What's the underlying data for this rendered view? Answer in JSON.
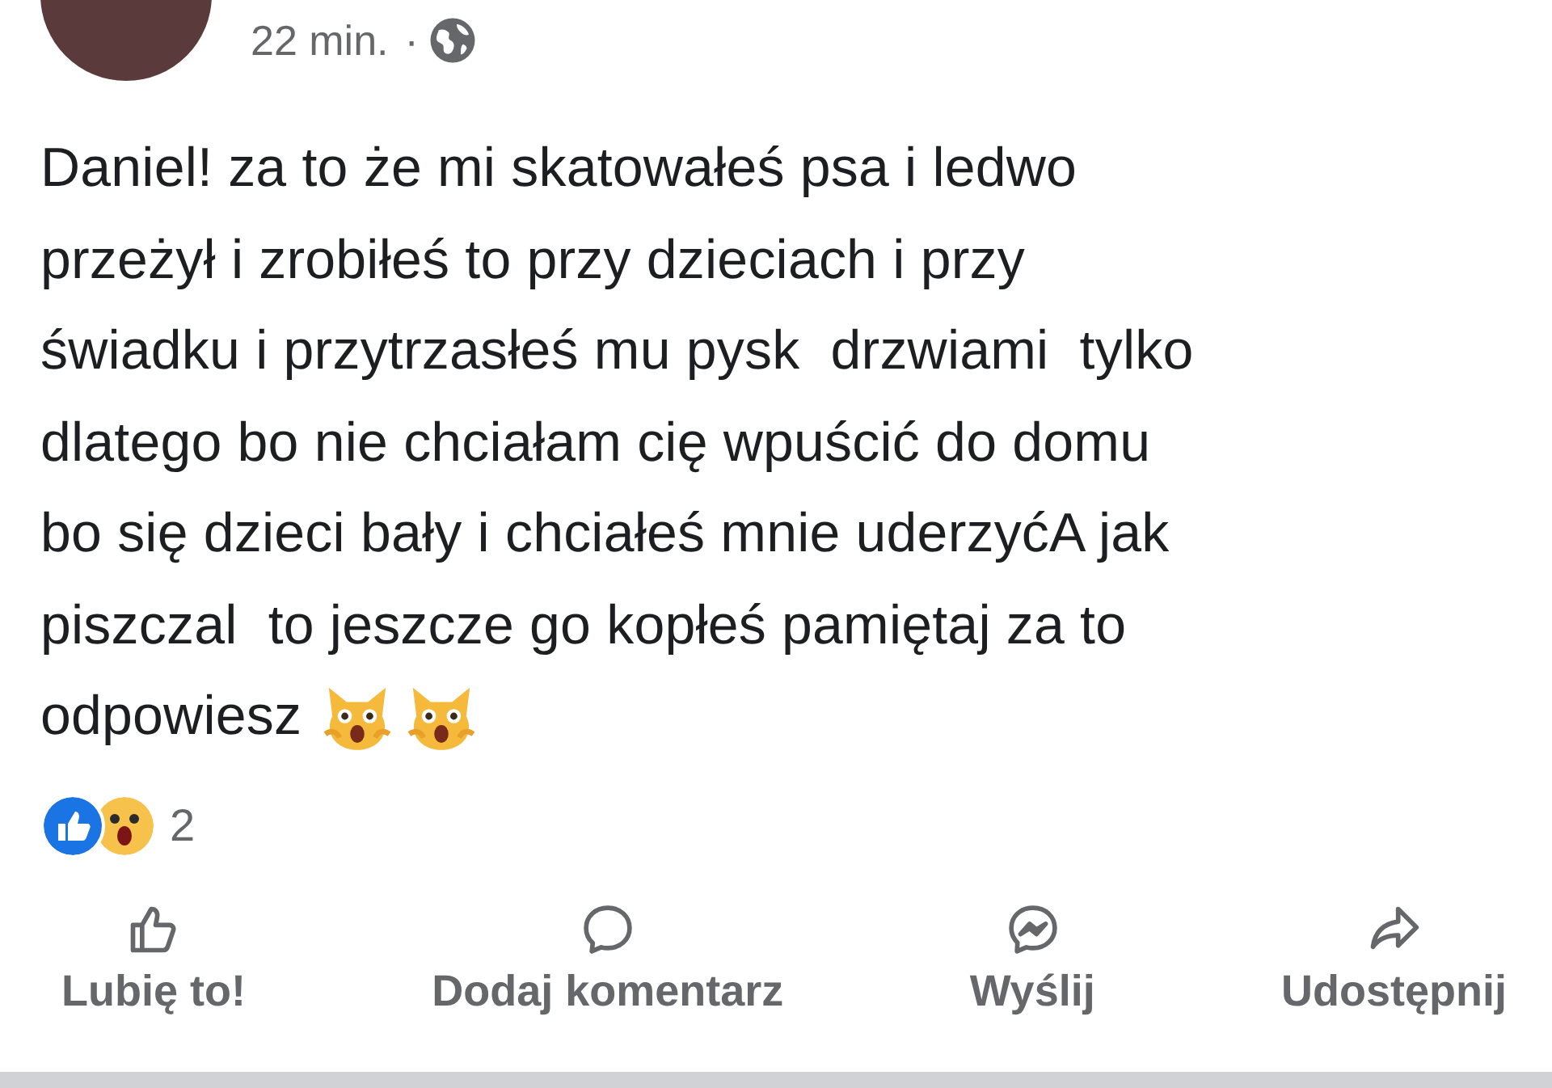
{
  "post": {
    "time": "22 min.",
    "separator": "·",
    "body_lines": [
      "Daniel! za to że mi skatowałeś psa i ledwo",
      "przeżył i zrobiłeś to przy dzieciach i przy",
      "świadku i przytrzasłeś mu pysk  drzwiami  tylko",
      "dlatego bo nie chciałam cię wpuścić do domu",
      "bo się dzieci bały i chciałeś mnie uderzyćA jak",
      "piszczal  to jeszcze go kopłeś pamiętaj za to",
      "odpowiesz"
    ],
    "trailing_emoji": [
      {
        "kind": "cat_scream"
      },
      {
        "kind": "cat_scream"
      }
    ],
    "reactions": {
      "icons": [
        {
          "kind": "like"
        },
        {
          "kind": "wow"
        }
      ],
      "count": "2"
    }
  },
  "actions": [
    {
      "kind": "like",
      "label": "Lubię to!"
    },
    {
      "kind": "comment",
      "label": "Dodaj komentarz"
    },
    {
      "kind": "send",
      "label": "Wyślij"
    },
    {
      "kind": "share",
      "label": "Udostępnij"
    }
  ]
}
